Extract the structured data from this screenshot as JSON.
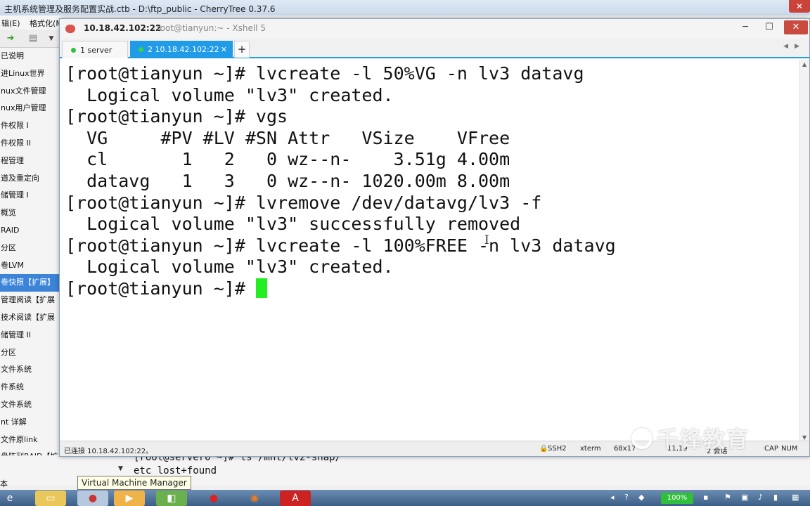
{
  "cherrytree": {
    "title": "主机系统管理及服务配置实战.ctb - D:\\ftp_public - CherryTree 0.37.6",
    "menu": [
      "辑(E)",
      "格式化(M"
    ],
    "tree_items": [
      "已说明",
      "进Linux世界",
      "nux文件管理",
      "nux用户管理",
      "件权限 I",
      "件权限 II",
      "程管理",
      "道及重定向",
      "储管理 I",
      "概览",
      "RAID",
      "分区",
      "卷LVM",
      "卷快照【扩展】",
      "管理阅读【扩展",
      "技术阅读【扩展",
      "储管理 II",
      "分区",
      "文件系统",
      "件系统",
      "文件系统",
      "nt 详解",
      "文件原link",
      "盘阵列RAID【扩"
    ],
    "selected_index": 13,
    "bottom_lines": [
      "[root@server0 ~]# ls /mnt/lv2-snap/",
      "etc  lost+found"
    ],
    "bottom_left_label": "本"
  },
  "tooltip": "Virtual Machine Manager",
  "xshell": {
    "host": "10.18.42.102:22",
    "subtitle": "root@tianyun:~ - Xshell 5",
    "tabs": [
      {
        "label": "1 server"
      },
      {
        "label": "2 10.18.42.102:22"
      }
    ],
    "terminal_lines": [
      "[root@tianyun ~]# lvcreate -l 50%VG -n lv3 datavg",
      "  Logical volume \"lv3\" created.",
      "[root@tianyun ~]# vgs",
      "  VG     #PV #LV #SN Attr   VSize    VFree",
      "  cl       1   2   0 wz--n-    3.51g 4.00m",
      "  datavg   1   3   0 wz--n- 1020.00m 8.00m",
      "[root@tianyun ~]# lvremove /dev/datavg/lv3 -f",
      "  Logical volume \"lv3\" successfully removed",
      "[root@tianyun ~]# lvcreate -l 100%FREE -n lv3 datavg",
      "  Logical volume \"lv3\" created."
    ],
    "prompt": "[root@tianyun ~]# ",
    "status": {
      "connection": "已连接 10.18.42.102:22。",
      "protocol": "SSH2",
      "term": "xterm",
      "size": "68x17",
      "pos": "11,19",
      "sessions": "2 会话",
      "caps": "CAP",
      "num": "NUM"
    }
  },
  "watermark": "千锋教育",
  "taskbar": {
    "battery": "100%"
  },
  "colors": {
    "tab_active": "#1f9be8",
    "cursor": "#22ee22",
    "tree_selected": "#3b84d8"
  }
}
